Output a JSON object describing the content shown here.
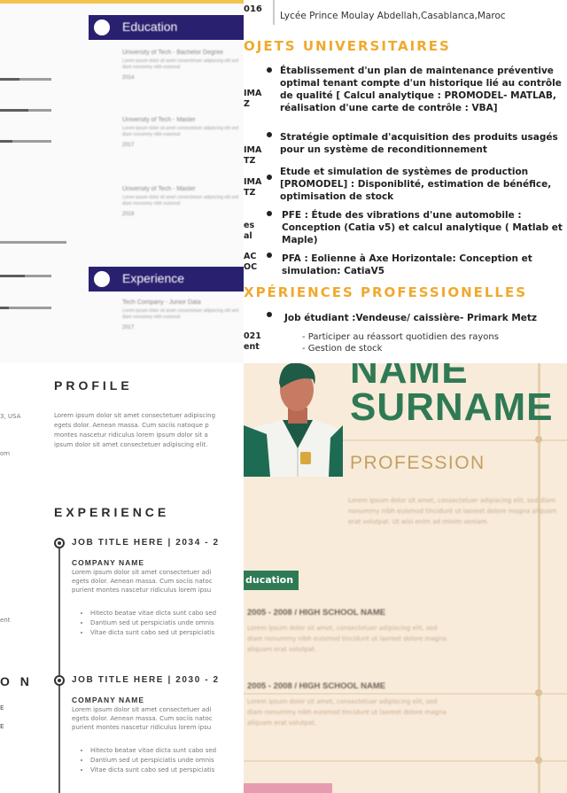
{
  "panel_a": {
    "education_heading": "Education",
    "experience_heading": "Experience",
    "education_items": [
      {
        "title": "University of Tech - Bachelor Degree",
        "desc": "Lorem ipsum dolor sit amet consectetuer adipiscing elit sed diam nonummy nibh euismod",
        "year": "2014"
      },
      {
        "title": "University of Tech - Master",
        "desc": "Lorem ipsum dolor sit amet consectetuer adipiscing elit sed diam nonummy nibh euismod",
        "year": "2017"
      },
      {
        "title": "University of Tech - Master",
        "desc": "Lorem ipsum dolor sit amet consectetuer adipiscing elit sed diam nonummy nibh euismod",
        "year": "2019"
      }
    ],
    "experience_item": {
      "title": "Tech Company - Junior Data",
      "desc": "Lorem ipsum dolor sit amet consectetuer adipiscing elit sed diam nonummy nibh euismod",
      "year": "2017"
    }
  },
  "panel_b": {
    "year_top": "016",
    "school": "Lycée Prince Moulay Abdellah,Casablanca,Maroc",
    "projects_heading": "OJETS UNIVERSITAIRES",
    "left_col": [
      "IMA\nZ",
      "IMA\nTZ",
      "IMA\nTZ",
      "es\nal",
      "AC\nOC"
    ],
    "projects": [
      "Établissement d'un plan de maintenance préventive optimal tenant compte d'un historique lié au contrôle de qualité [ Calcul analytique : PROMODEL- MATLAB, réalisation d'une carte de contrôle : VBA]",
      "Stratégie optimale d'acquisition des produits usagés pour un système de reconditionnement",
      "Etude et simulation de systèmes de production [PROMODEL] : Disponiblité, estimation de bénéfice, optimisation de stock",
      "PFE : Étude des vibrations d'une automobile : Conception (Catia v5) et calcul analytique ( Matlab et Maple)",
      "PFA : Eolienne à Axe Horizontale: Conception et simulation: CatiaV5"
    ],
    "experience_heading": "XPÉRIENCES PROFESSIONELLES",
    "job_title": "Job étudiant :Vendeuse/ caissière- Primark Metz",
    "job_left": "021\nent",
    "job_tasks": [
      "- Participer au réassort quotidien des rayons",
      "- Gestion de stock"
    ]
  },
  "panel_c": {
    "profile_heading": "PROFILE",
    "side_location": "3, USA",
    "side_email": "om",
    "side_ent": "ent",
    "side_section": "O N",
    "side_marks": [
      "E",
      "E"
    ],
    "profile_text": [
      "Lorem ipsum dolor sit amet consectetuer adipiscing",
      "egets dolor. Aenean massa. Cum sociis natoque p",
      "montes nascetur ridiculus lorem ipsum dolor sit a",
      "ipsum dolor sit amet consectetuer adipiscing elit."
    ],
    "experience_heading": "EXPERIENCE",
    "jobs": [
      {
        "title": "JOB TITLE HERE  |  2034 - 2",
        "company": "COMPANY NAME",
        "desc": [
          "Lorem ipsum dolor sit amet consectetuer adi",
          "egets dolor. Aenean massa. Cum sociis natoc",
          "purient montes nascetur ridiculus lorem ipsu"
        ],
        "bullets": [
          "Hitecto beatae vitae dicta sunt cabo sed",
          "Dantium sed ut perspiciatis unde omnis",
          "Vitae dicta sunt cabo sed ut perspiciatis"
        ]
      },
      {
        "title": "JOB TITLE HERE  |  2030 - 2",
        "company": "COMPANY NAME",
        "desc": [
          "Lorem ipsum dolor sit amet consectetuer adi",
          "egets dolor. Aenean massa. Cum sociis natoc",
          "purient montes nascetur ridiculus lorem ipsu"
        ],
        "bullets": [
          "Hitecto beatae vitae dicta sunt cabo sed",
          "Dantium sed ut perspiciatis unde omnis",
          "Vitae dicta sunt cabo sed ut perspiciatis"
        ]
      }
    ]
  },
  "panel_d": {
    "name_line1": "NAME",
    "name_line2": "SURNAME",
    "profession": "PROFESSION",
    "profile_text": [
      "Lorem ipsum dolor sit amet, consectetuer adipiscing elit, sed diam",
      "nonummy nibh euismod tincidunt ut laoreet dolore magna aliquam",
      "erat volutpat. Ut wisi enim ad minim veniam."
    ],
    "education_tag": "ducation",
    "schools": [
      {
        "title": "2005 - 2008  /  HIGH SCHOOL NAME",
        "desc": [
          "Lorem ipsum dolor sit amet, consectetuer adipiscing elit, sed",
          "diam nonummy nibh euismod tincidunt ut laoreet dolore magna",
          "aliquam erat volutpat."
        ]
      },
      {
        "title": "2005 - 2008  /  HIGH SCHOOL NAME",
        "desc": [
          "Lorem ipsum dolor sit amet, consectetuer adipiscing elit, sed",
          "diam nonummy nibh euismod tincidunt ut laoreet dolore magna",
          "aliquam erat volutpat."
        ]
      }
    ],
    "colors": {
      "accent": "#2f7a55",
      "gold": "#c3a061",
      "background": "#f8ebda"
    }
  }
}
